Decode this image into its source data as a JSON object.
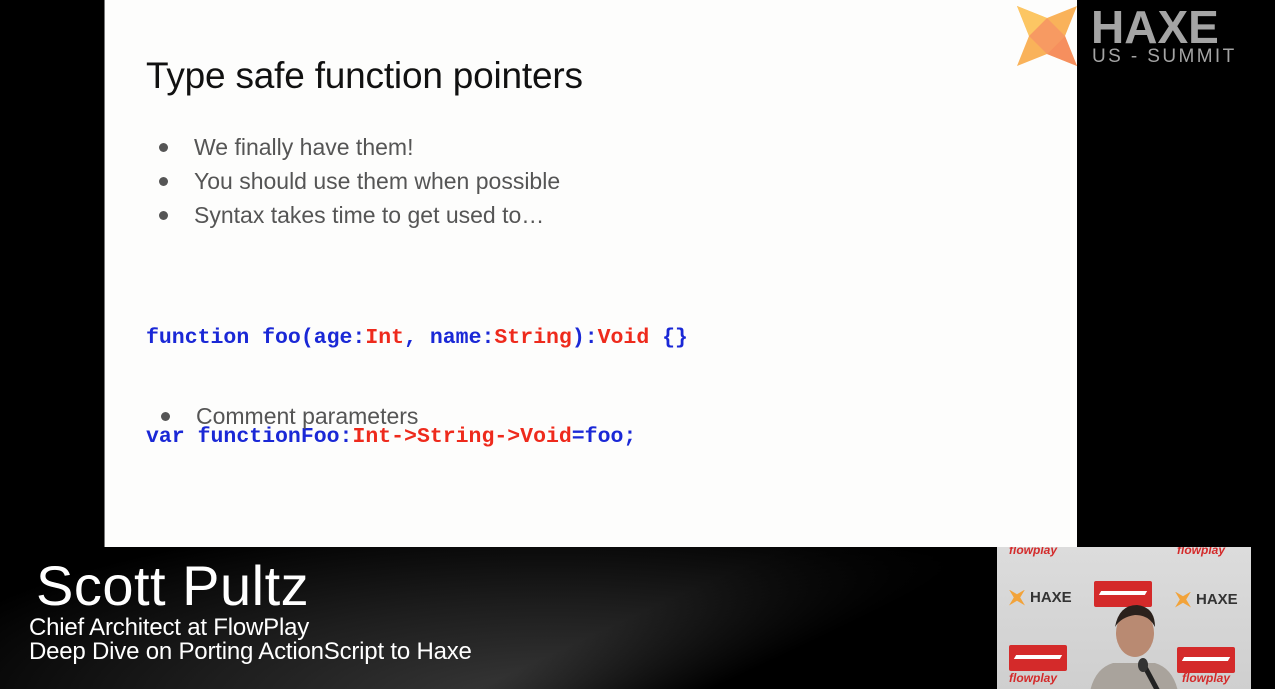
{
  "slide": {
    "title": "Type safe function pointers",
    "bullets": [
      "We finally have them!",
      "You should use them when possible",
      "Syntax takes time to get used to…"
    ],
    "code": {
      "line1": [
        {
          "t": "function foo(age:",
          "c": "kw"
        },
        {
          "t": "Int",
          "c": "ty"
        },
        {
          "t": ", name:",
          "c": "kw"
        },
        {
          "t": "String",
          "c": "ty"
        },
        {
          "t": "):",
          "c": "kw"
        },
        {
          "t": "Void",
          "c": "ty"
        },
        {
          "t": " {}",
          "c": "kw"
        }
      ],
      "line2": [
        {
          "t": "var functionFoo:",
          "c": "kw"
        },
        {
          "t": "Int->String->Void",
          "c": "ty"
        },
        {
          "t": "=foo;",
          "c": "kw"
        }
      ]
    },
    "bullets2": [
      "Comment parameters"
    ]
  },
  "branding": {
    "logo_icon": "haxe-logo-icon",
    "logo_title": "HAXE",
    "logo_subtitle": "US - SUMMIT"
  },
  "lower_third": {
    "speaker_name": "Scott Pultz",
    "speaker_role": "Chief Architect at FlowPlay",
    "talk_title": "Deep Dive on Porting ActionScript to Haxe"
  },
  "webcam": {
    "banner_text": "flowplay",
    "haxe_text": "HAXE"
  },
  "colors": {
    "code_keyword": "#1a28d6",
    "code_type": "#ee2a1c",
    "logo_orange": "#f7a556",
    "flowplay_red": "#d42a2a"
  }
}
